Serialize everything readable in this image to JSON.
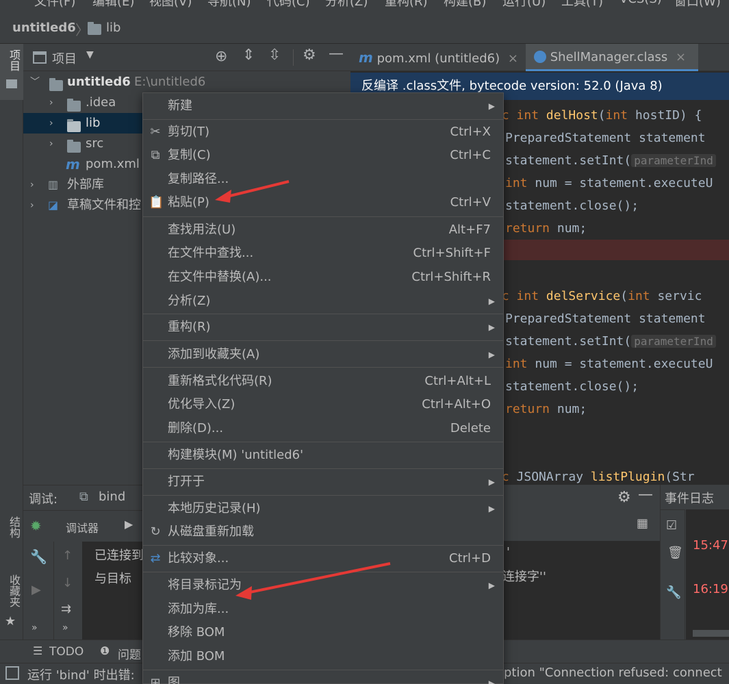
{
  "menubar": [
    "文件(F)",
    "编辑(E)",
    "视图(V)",
    "导航(N)",
    "代码(C)",
    "分析(Z)",
    "重构(R)",
    "构建(B)",
    "运行(U)",
    "工具(T)",
    "VCS(S)",
    "窗口(W)"
  ],
  "breadcrumb": {
    "project": "untitled6",
    "folder": "lib"
  },
  "left_stripe": {
    "project": "项目",
    "structure": "结构",
    "favorites": "收藏夹"
  },
  "project_panel": {
    "title": "项目",
    "tree": [
      {
        "label": "untitled6",
        "path": "E:\\untitled6"
      },
      {
        "label": ".idea"
      },
      {
        "label": "lib"
      },
      {
        "label": "src"
      },
      {
        "label": "pom.xml"
      },
      {
        "label": "外部库"
      },
      {
        "label": "草稿文件和控"
      }
    ]
  },
  "editor": {
    "tabs": [
      {
        "label": "pom.xml (untitled6)"
      },
      {
        "label": "ShellManager.class"
      }
    ],
    "decompile_banner": "反编译 .class文件, bytecode version: 52.0 (Java 8)",
    "code": {
      "l1_kw": "ic",
      "l1_type": "int",
      "l1_fn": "delHost",
      "l1_paren": "(",
      "l1_type2": "int",
      "l1_rest": " hostID) {",
      "l2": "PreparedStatement statement",
      "l3": "statement.setInt(",
      "l3_hint": "parameterInd",
      "l4_kw": "int",
      "l4_rest": " num = statement.executeU",
      "l5": "statement.close();",
      "l6_kw": "return",
      "l6_rest": " num;",
      "l7_kw": "ic",
      "l7_type": "int",
      "l7_fn": "delService",
      "l7_paren": "(",
      "l7_type2": "int",
      "l7_rest": " servic",
      "l8": "PreparedStatement statement",
      "l9": "statement.setInt(",
      "l9_hint": "parameterInd",
      "l10_kw": "int",
      "l10_rest": " num = statement.executeU",
      "l11": "statement.close();",
      "l12_kw": "return",
      "l12_rest": " num;",
      "l13_kw": "ic",
      "l13_rest": " JSONArray ",
      "l13_fn": "listPlugin",
      "l13_end": "(Str"
    }
  },
  "debug": {
    "label": "调试:",
    "config": "bind",
    "debugger_tab": "调试器",
    "console_lines": [
      "已连接到",
      "与目标"
    ],
    "console_right_lines": [
      "'",
      "连接字''"
    ]
  },
  "event_log": {
    "title": "事件日志",
    "times": [
      "15:47",
      "16:19"
    ]
  },
  "bottom_tabs": {
    "todo": "TODO",
    "problems": "问题"
  },
  "status": {
    "left": "运行 'bind' 时出错:",
    "right": "ption \"Connection refused: connect"
  },
  "context_menu": {
    "items": [
      {
        "label": "新建",
        "shortcut": ""
      },
      {
        "label": "剪切(T)",
        "shortcut": "Ctrl+X"
      },
      {
        "label": "复制(C)",
        "shortcut": "Ctrl+C"
      },
      {
        "label": "复制路径...",
        "shortcut": ""
      },
      {
        "label": "粘贴(P)",
        "shortcut": "Ctrl+V"
      },
      {
        "label": "查找用法(U)",
        "shortcut": "Alt+F7"
      },
      {
        "label": "在文件中查找...",
        "shortcut": "Ctrl+Shift+F"
      },
      {
        "label": "在文件中替换(A)...",
        "shortcut": "Ctrl+Shift+R"
      },
      {
        "label": "分析(Z)",
        "shortcut": ""
      },
      {
        "label": "重构(R)",
        "shortcut": ""
      },
      {
        "label": "添加到收藏夹(A)",
        "shortcut": ""
      },
      {
        "label": "重新格式化代码(R)",
        "shortcut": "Ctrl+Alt+L"
      },
      {
        "label": "优化导入(Z)",
        "shortcut": "Ctrl+Alt+O"
      },
      {
        "label": "删除(D)...",
        "shortcut": "Delete"
      },
      {
        "label": "构建模块(M) 'untitled6'",
        "shortcut": ""
      },
      {
        "label": "打开于",
        "shortcut": ""
      },
      {
        "label": "本地历史记录(H)",
        "shortcut": ""
      },
      {
        "label": "从磁盘重新加载",
        "shortcut": ""
      },
      {
        "label": "比较对象...",
        "shortcut": "Ctrl+D"
      },
      {
        "label": "将目录标记为",
        "shortcut": ""
      },
      {
        "label": "添加为库...",
        "shortcut": ""
      },
      {
        "label": "移除 BOM",
        "shortcut": ""
      },
      {
        "label": "添加 BOM",
        "shortcut": ""
      },
      {
        "label": "图",
        "shortcut": ""
      }
    ]
  },
  "colors": {
    "accent": "#4a88c7",
    "annotation_arrow": "#e53935",
    "selection": "#0d293e",
    "time": "#ff6b68"
  }
}
